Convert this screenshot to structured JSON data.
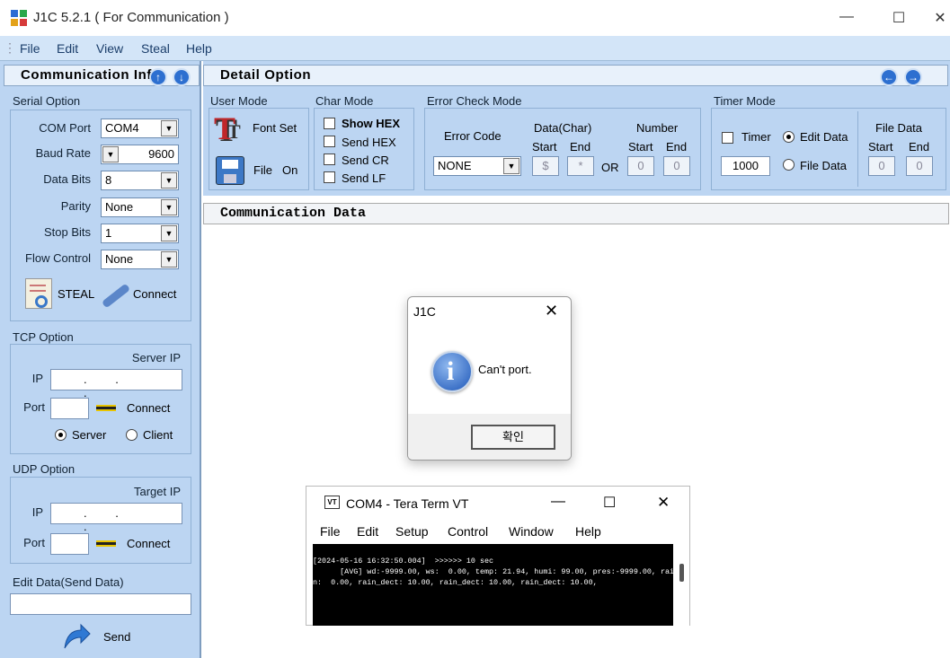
{
  "app": {
    "title": "J1C 5.2.1 ( For Communication )",
    "minimize": "—",
    "maximize": "☐",
    "close": "✕"
  },
  "menu": [
    "File",
    "Edit",
    "View",
    "Steal",
    "Help"
  ],
  "left": {
    "header": "Communication Info",
    "serial": {
      "title": "Serial Option",
      "com_port_label": "COM Port",
      "com_port": "COM4",
      "baud_label": "Baud Rate",
      "baud": "9600",
      "databits_label": "Data Bits",
      "databits": "8",
      "parity_label": "Parity",
      "parity": "None",
      "stopbits_label": "Stop Bits",
      "stopbits": "1",
      "flow_label": "Flow Control",
      "flow": "None",
      "steal": "STEAL",
      "connect": "Connect"
    },
    "tcp": {
      "title": "TCP Option",
      "server_ip_label": "Server IP",
      "ip_label": "IP",
      "ip_dots": ". . .",
      "port_label": "Port",
      "connect": "Connect",
      "server": "Server",
      "client": "Client"
    },
    "udp": {
      "title": "UDP Option",
      "target_ip_label": "Target IP",
      "ip_label": "IP",
      "ip_dots": ". . .",
      "port_label": "Port",
      "connect": "Connect"
    },
    "edit": {
      "title": "Edit Data(Send Data)",
      "value": "",
      "send": "Send"
    }
  },
  "detail": {
    "header": "Detail Option",
    "user_mode": {
      "title": "User Mode",
      "font_set": "Font Set",
      "file": "File",
      "on": "On"
    },
    "char_mode": {
      "title": "Char Mode",
      "show_hex": "Show HEX",
      "send_hex": "Send HEX",
      "send_cr": "Send CR",
      "send_lf": "Send LF"
    },
    "error_check": {
      "title": "Error Check Mode",
      "error_code": "Error Code",
      "error_value": "NONE",
      "data_char": "Data(Char)",
      "start": "Start",
      "end": "End",
      "start_val": "$",
      "end_val": "*",
      "or": "OR",
      "number": "Number",
      "num_start": "0",
      "num_end": "0"
    },
    "timer_mode": {
      "title": "Timer Mode",
      "timer": "Timer",
      "edit_data": "Edit Data",
      "file_data": "File Data",
      "timer_val": "1000",
      "file_data_title": "File Data",
      "start": "Start",
      "end": "End",
      "fd_start": "0",
      "fd_end": "0"
    }
  },
  "comm_data_header": "Communication Data",
  "dialog": {
    "title": "J1C",
    "message": "Can't port.",
    "ok": "확인"
  },
  "teraterm": {
    "title": "COM4 - Tera Term VT",
    "menu": [
      "File",
      "Edit",
      "Setup",
      "Control",
      "Window",
      "Help"
    ],
    "lines": [
      "[2024-05-16 16:32:50.004]  >>>>>> 10 sec",
      "      [AVG] wd:-9999.00, ws:  0.00, temp: 21.94, humi: 99.00, pres:-9999.00, rai",
      "n:  0.00, rain_dect: 10.00, rain_dect: 10.00, rain_dect: 10.00,"
    ]
  }
}
